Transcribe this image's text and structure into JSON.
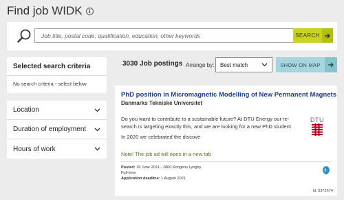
{
  "header": {
    "title": "Find job WIDK",
    "info_icon": "info-icon"
  },
  "search": {
    "placeholder": "Job title, postal code, qualification, education, other keywords",
    "value": "",
    "button_label": "SEARCH",
    "icons": [
      "search-icon",
      "arrow-right-icon"
    ],
    "accent_color": "#c9d41f"
  },
  "criteria": {
    "heading": "Selected search criteria",
    "text": "No search criteria - select below"
  },
  "filters": [
    {
      "label": "Location"
    },
    {
      "label": "Duration of employment"
    },
    {
      "label": "Hours of work"
    }
  ],
  "results": {
    "count_label": "3030 Job postings",
    "arrange_label": "Arrange by:",
    "arrange_selected": "Best match",
    "map_button_label": "SHOW ON MAP",
    "map_button_color": "#a7d5dd"
  },
  "job": {
    "title": "PhD position in Micromagnetic Modelling of New Permanent Magnets",
    "company": "Danmarks Tekniske Universitet",
    "description": "Do you want to contribute to a sustainable future? At DTU Energy our re-search is targeting exactly this, and we are looking for a new PhD student.",
    "description2": "In 2020 we celebrated the discove",
    "note": "Note! The job ad will open in a new tab",
    "posted_label": "Posted:",
    "posted_value": "18 June 2021 - 2800 Kongens Lyngby",
    "hours": "Full-time",
    "deadline_label": "Application deadline:",
    "deadline_value": "1 August 2021",
    "id": "Id: 5372674",
    "logo": "DTU",
    "title_color": "#1a3e80",
    "note_color": "#4a7a20"
  }
}
